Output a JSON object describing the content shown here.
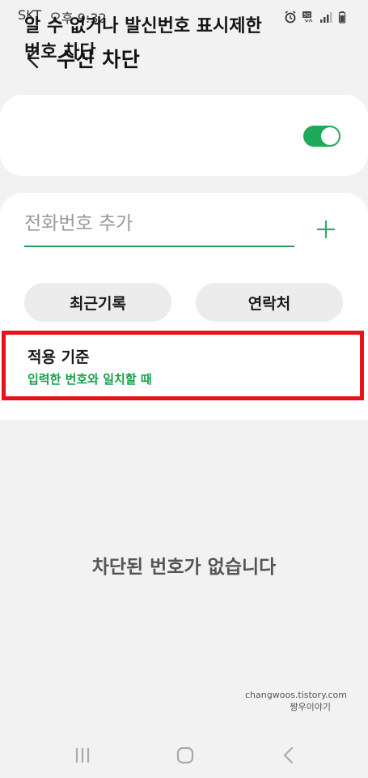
{
  "status_bar": {
    "carrier": "SKT",
    "time": "오후 9:32",
    "icons": [
      "alarm-icon",
      "5g-icon",
      "signal-icon",
      "battery-icon"
    ]
  },
  "header": {
    "title": "수신 차단",
    "back_icon": "chevron-left-icon"
  },
  "block_unknown": {
    "label": "알 수 없거나 발신번호 표시제한 번호 차단",
    "enabled": true
  },
  "add_number": {
    "placeholder": "전화번호 추가",
    "value": "",
    "add_icon": "plus-icon"
  },
  "sources": {
    "recent_label": "최근기록",
    "contacts_label": "연락처"
  },
  "criteria": {
    "title": "적용 기준",
    "value": "입력한 번호와 일치할 때"
  },
  "empty_message": "차단된 번호가 없습니다",
  "watermark": {
    "line1": "changwoos.tistory.com",
    "line2": "짱우이야기"
  },
  "nav": {
    "recents_icon": "recent-apps-icon",
    "home_icon": "home-icon",
    "back_icon": "back-icon"
  },
  "colors": {
    "accent": "#1faa59",
    "criteria_text": "#18a04a",
    "highlight_border": "#e8131a",
    "background": "#f2f2f2"
  }
}
